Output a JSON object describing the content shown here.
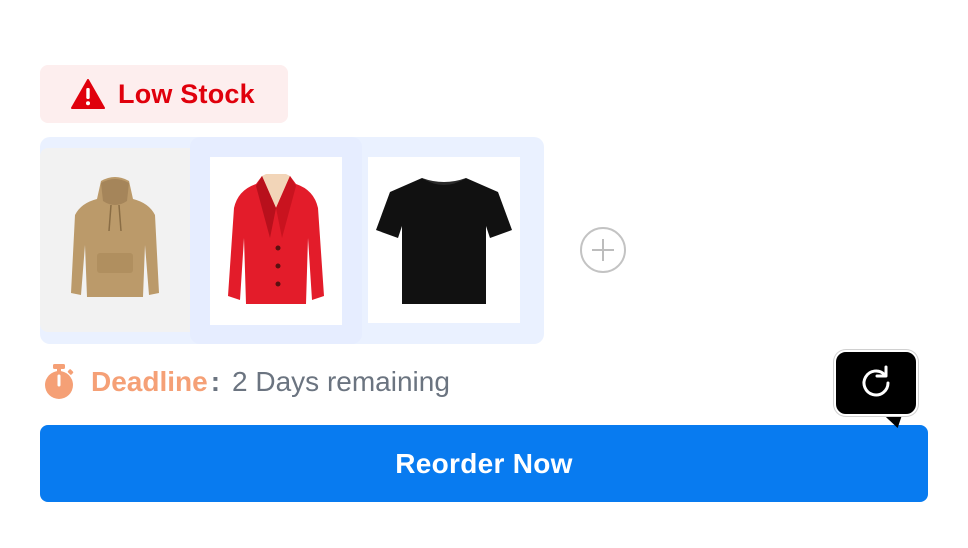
{
  "badge": {
    "label": "Low Stock",
    "icon": "warning-triangle-icon",
    "color": "#e0000c",
    "background": "#fdeeee"
  },
  "products": [
    {
      "name": "hoodie-thumbnail",
      "icon": "hoodie-icon"
    },
    {
      "name": "red-blazer-thumbnail",
      "icon": "blazer-icon"
    },
    {
      "name": "black-tshirt-thumbnail",
      "icon": "tshirt-icon"
    }
  ],
  "add_product": {
    "icon": "plus-circle-icon"
  },
  "deadline": {
    "icon": "stopwatch-icon",
    "label": "Deadline",
    "separator": ":",
    "value": "2 Days remaining",
    "label_color": "#f5a076"
  },
  "reorder": {
    "label": "Reorder Now",
    "color": "#087bf0"
  },
  "refresh": {
    "icon": "refresh-icon"
  }
}
